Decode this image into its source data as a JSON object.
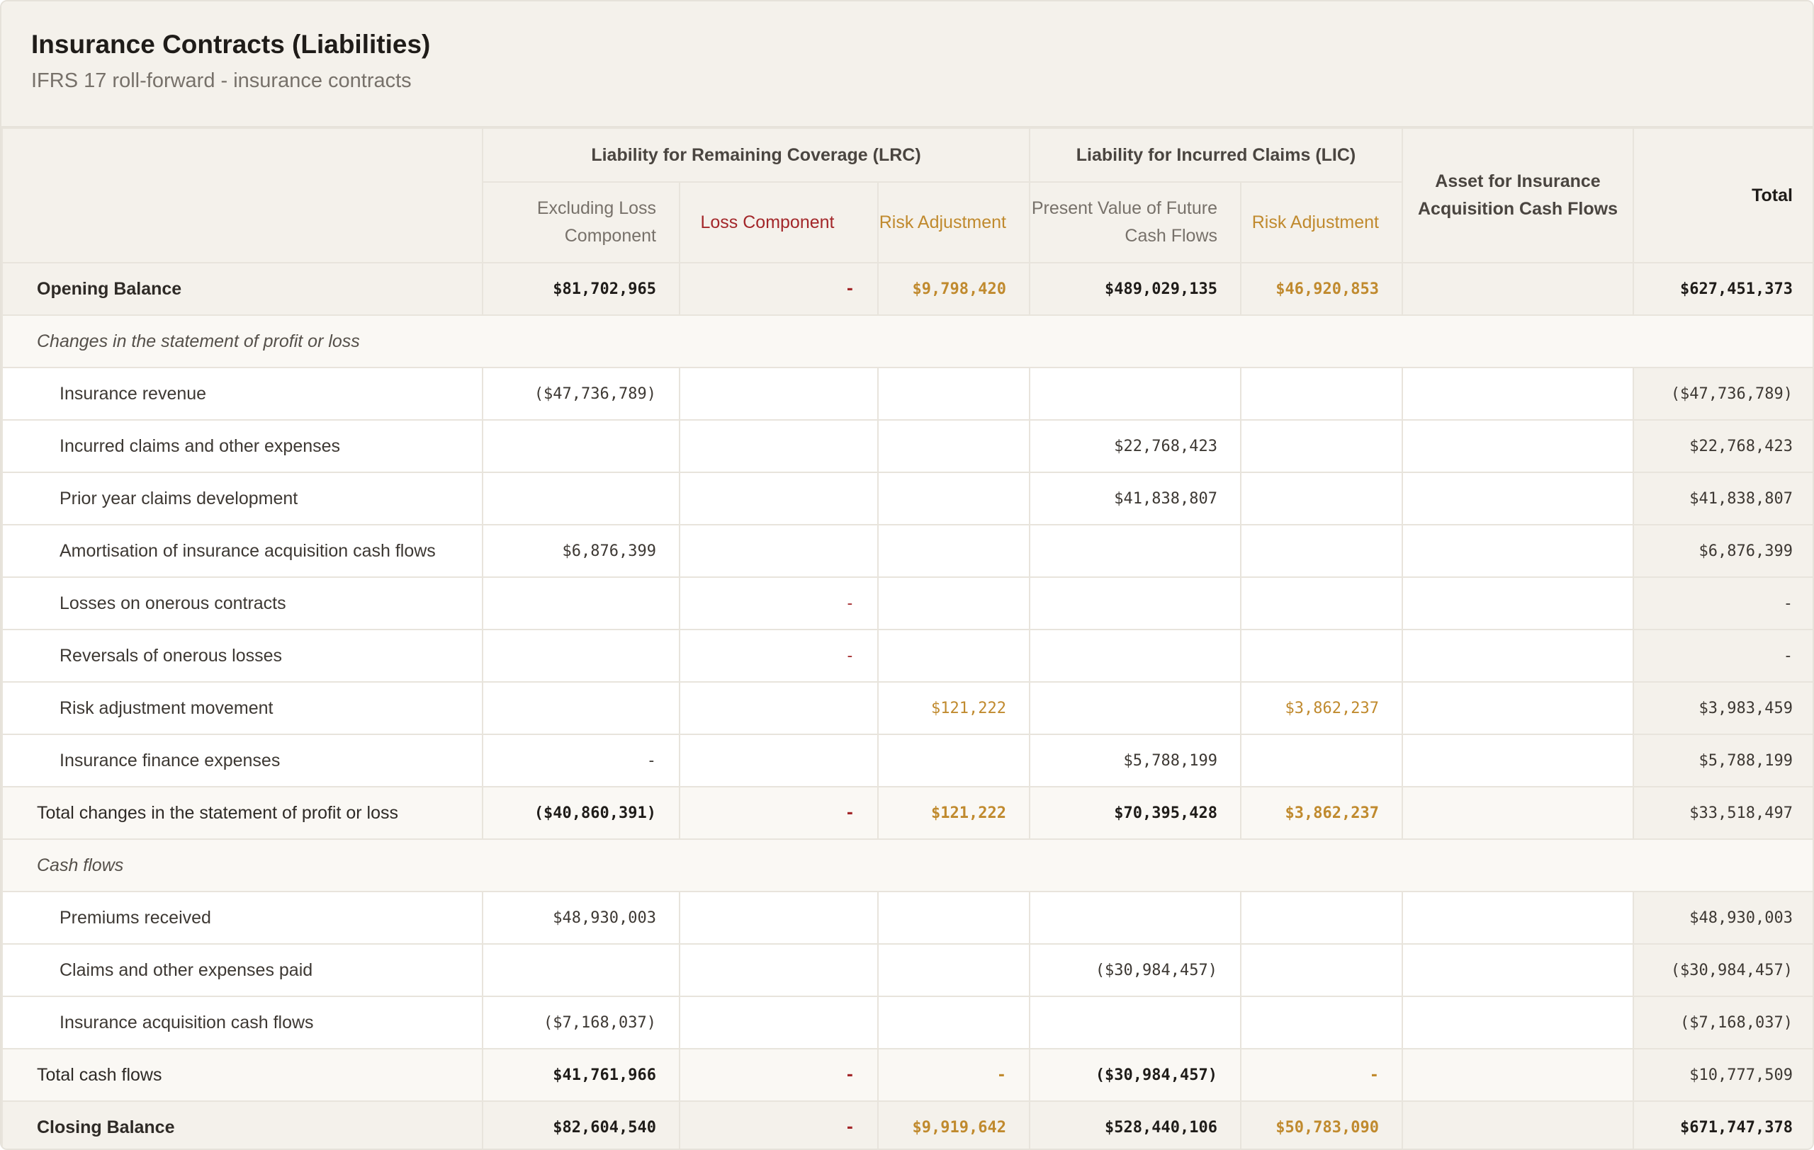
{
  "header": {
    "title": "Insurance Contracts (Liabilities)",
    "subtitle": "IFRS 17 roll-forward - insurance contracts"
  },
  "columns": {
    "lrc_group": "Liability for Remaining Coverage (LRC)",
    "lic_group": "Liability for Incurred Claims (LIC)",
    "assets": "Asset for Insurance Acquisition Cash Flows",
    "total": "Total",
    "excluding_loss": "Excluding Loss Component",
    "loss_component": "Loss Component",
    "lrc_risk": "Risk Adjustment",
    "pv_future": "Present Value of Future Cash Flows",
    "lic_risk": "Risk Adjustment"
  },
  "rows": {
    "opening": {
      "label": "Opening Balance",
      "excl": "$81,702,965",
      "loss": "-",
      "lrc_ra": "$9,798,420",
      "pv": "$489,029,135",
      "lic_ra": "$46,920,853",
      "asset": "",
      "total": "$627,451,373"
    },
    "section_pl": {
      "label": "Changes in the statement of profit or loss"
    },
    "ins_revenue": {
      "label": "Insurance revenue",
      "excl": "($47,736,789)",
      "total": "($47,736,789)"
    },
    "incurred_claims": {
      "label": "Incurred claims and other expenses",
      "pv": "$22,768,423",
      "total": "$22,768,423"
    },
    "prior_year": {
      "label": "Prior year claims development",
      "pv": "$41,838,807",
      "total": "$41,838,807"
    },
    "amortisation": {
      "label": "Amortisation of insurance acquisition cash flows",
      "excl": "$6,876,399",
      "total": "$6,876,399"
    },
    "onerous_losses": {
      "label": "Losses on onerous contracts",
      "loss": "-",
      "total": "-"
    },
    "onerous_reversals": {
      "label": "Reversals of onerous losses",
      "loss": "-",
      "total": "-"
    },
    "ra_movement": {
      "label": "Risk adjustment movement",
      "lrc_ra": "$121,222",
      "lic_ra": "$3,862,237",
      "total": "$3,983,459"
    },
    "finance_exp": {
      "label": "Insurance finance expenses",
      "excl": "-",
      "pv": "$5,788,199",
      "total": "$5,788,199"
    },
    "total_pl": {
      "label": "Total changes in the statement of profit or loss",
      "excl": "($40,860,391)",
      "loss": "-",
      "lrc_ra": "$121,222",
      "pv": "$70,395,428",
      "lic_ra": "$3,862,237",
      "total": "$33,518,497"
    },
    "section_cf": {
      "label": "Cash flows"
    },
    "premiums": {
      "label": "Premiums received",
      "excl": "$48,930,003",
      "total": "$48,930,003"
    },
    "claims_paid": {
      "label": "Claims and other expenses paid",
      "pv": "($30,984,457)",
      "total": "($30,984,457)"
    },
    "acq_cash": {
      "label": "Insurance acquisition cash flows",
      "excl": "($7,168,037)",
      "total": "($7,168,037)"
    },
    "total_cf": {
      "label": "Total cash flows",
      "excl": "$41,761,966",
      "loss": "-",
      "lrc_ra": "-",
      "pv": "($30,984,457)",
      "lic_ra": "-",
      "total": "$10,777,509"
    },
    "closing": {
      "label": "Closing Balance",
      "excl": "$82,604,540",
      "loss": "-",
      "lrc_ra": "$9,919,642",
      "pv": "$528,440,106",
      "lic_ra": "$50,783,090",
      "asset": "",
      "total": "$671,747,378"
    }
  },
  "colors": {
    "loss": "#a3272a",
    "risk": "#c08a2e",
    "header_bg": "#f4f1eb"
  }
}
